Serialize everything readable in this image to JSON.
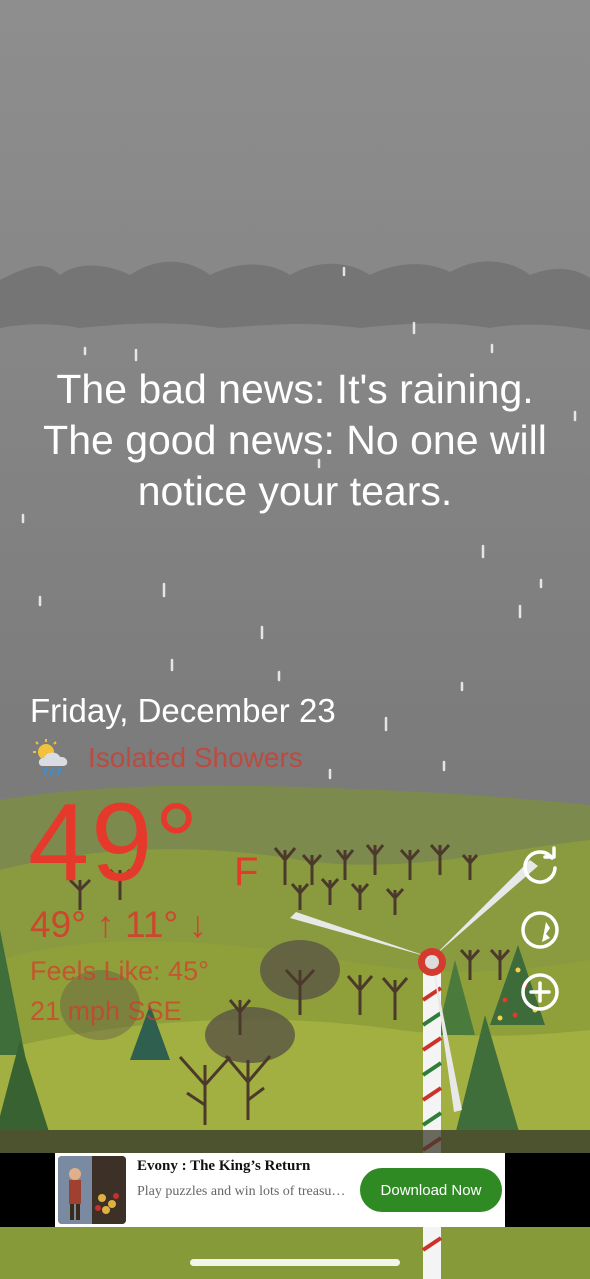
{
  "headline": {
    "line1": "The bad news: It's raining.",
    "line2": "The good news: No one will",
    "line3": "notice your tears."
  },
  "weather": {
    "date": "Friday, December 23",
    "condition": "Isolated Showers",
    "condition_icon": "partly-cloudy-rain-icon",
    "temperature": "49°",
    "unit": "F",
    "hi_lo": "49° ↑  11° ↓",
    "feels_like": "Feels Like: 45°",
    "wind": "21 mph SSE"
  },
  "buttons": {
    "refresh": "refresh-icon",
    "location": "location-globe-icon",
    "add": "add-circle-icon"
  },
  "ad": {
    "title": "Evony : The King’s Return",
    "subtitle": "Play puzzles and win lots of treasure...",
    "cta": "Download Now"
  },
  "colors": {
    "temperature": "#e53a2b",
    "cta": "#2f8a24",
    "grass": "#7f8f3a",
    "sky": "#858585"
  }
}
